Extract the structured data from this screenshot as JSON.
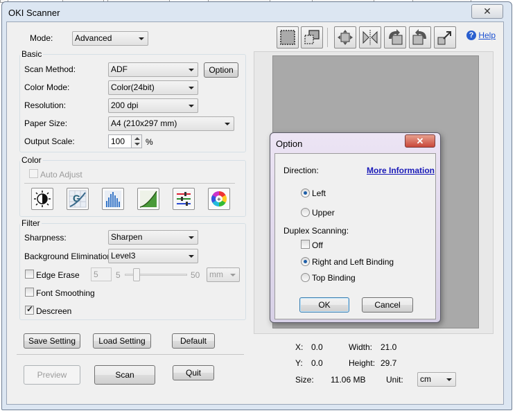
{
  "window": {
    "title": "OKI Scanner",
    "close_glyph": "✕"
  },
  "mode": {
    "label": "Mode:",
    "value": "Advanced"
  },
  "basic": {
    "group_title": "Basic",
    "scan_method": {
      "label": "Scan Method:",
      "value": "ADF",
      "option_button": "Option"
    },
    "color_mode": {
      "label": "Color Mode:",
      "value": "Color(24bit)"
    },
    "resolution": {
      "label": "Resolution:",
      "value": "200 dpi"
    },
    "paper_size": {
      "label": "Paper Size:",
      "value": "A4 (210x297 mm)"
    },
    "output_scale": {
      "label": "Output Scale:",
      "value": "100",
      "unit": "%"
    }
  },
  "color": {
    "group_title": "Color",
    "auto_adjust": {
      "label": "Auto Adjust",
      "checked": false,
      "enabled": false
    },
    "tools": [
      "brightness-contrast-icon",
      "gamma-icon",
      "histogram-icon",
      "tone-curve-icon",
      "color-balance-icon",
      "hue-saturation-icon"
    ]
  },
  "filter": {
    "group_title": "Filter",
    "sharpness": {
      "label": "Sharpness:",
      "value": "Sharpen"
    },
    "background_elimination": {
      "label": "Background Elimination:",
      "value": "Level3"
    },
    "edge_erase": {
      "label": "Edge Erase",
      "checked": false,
      "value": "5",
      "min": "5",
      "max": "50",
      "unit": "mm"
    },
    "font_smoothing": {
      "label": "Font Smoothing",
      "checked": false
    },
    "descreen": {
      "label": "Descreen",
      "checked": true
    }
  },
  "settings_buttons": {
    "save": "Save Setting",
    "load": "Load Setting",
    "default": "Default"
  },
  "actions": {
    "preview": "Preview",
    "scan": "Scan",
    "quit": "Quit"
  },
  "toolbar": {
    "tools": [
      "select-area-icon",
      "auto-crop-icon",
      "fit-page-icon",
      "flip-horizontal-icon",
      "rotate-left-icon",
      "rotate-right-icon",
      "zoom-icon"
    ],
    "help_label": "Help"
  },
  "info": {
    "x_label": "X:",
    "x_value": "0.0",
    "y_label": "Y:",
    "y_value": "0.0",
    "width_label": "Width:",
    "width_value": "21.0",
    "height_label": "Height:",
    "height_value": "29.7",
    "size_label": "Size:",
    "size_value": "11.06 MB",
    "unit_label": "Unit:",
    "unit_value": "cm"
  },
  "option_dialog": {
    "title": "Option",
    "close_glyph": "✕",
    "direction_label": "Direction:",
    "more_info": "More Information",
    "direction_options": [
      {
        "label": "Left",
        "selected": true
      },
      {
        "label": "Upper",
        "selected": false
      }
    ],
    "duplex_label": "Duplex Scanning:",
    "duplex_off": {
      "label": "Off",
      "checked": false
    },
    "duplex_options": [
      {
        "label": "Right and Left Binding",
        "selected": true
      },
      {
        "label": "Top Binding",
        "selected": false
      }
    ],
    "ok": "OK",
    "cancel": "Cancel"
  },
  "colors": {
    "window_frame": "#dce6f2",
    "client_bg": "#f0f0f0",
    "preview_page": "#a9a9a9",
    "link": "#1a1ab8"
  }
}
